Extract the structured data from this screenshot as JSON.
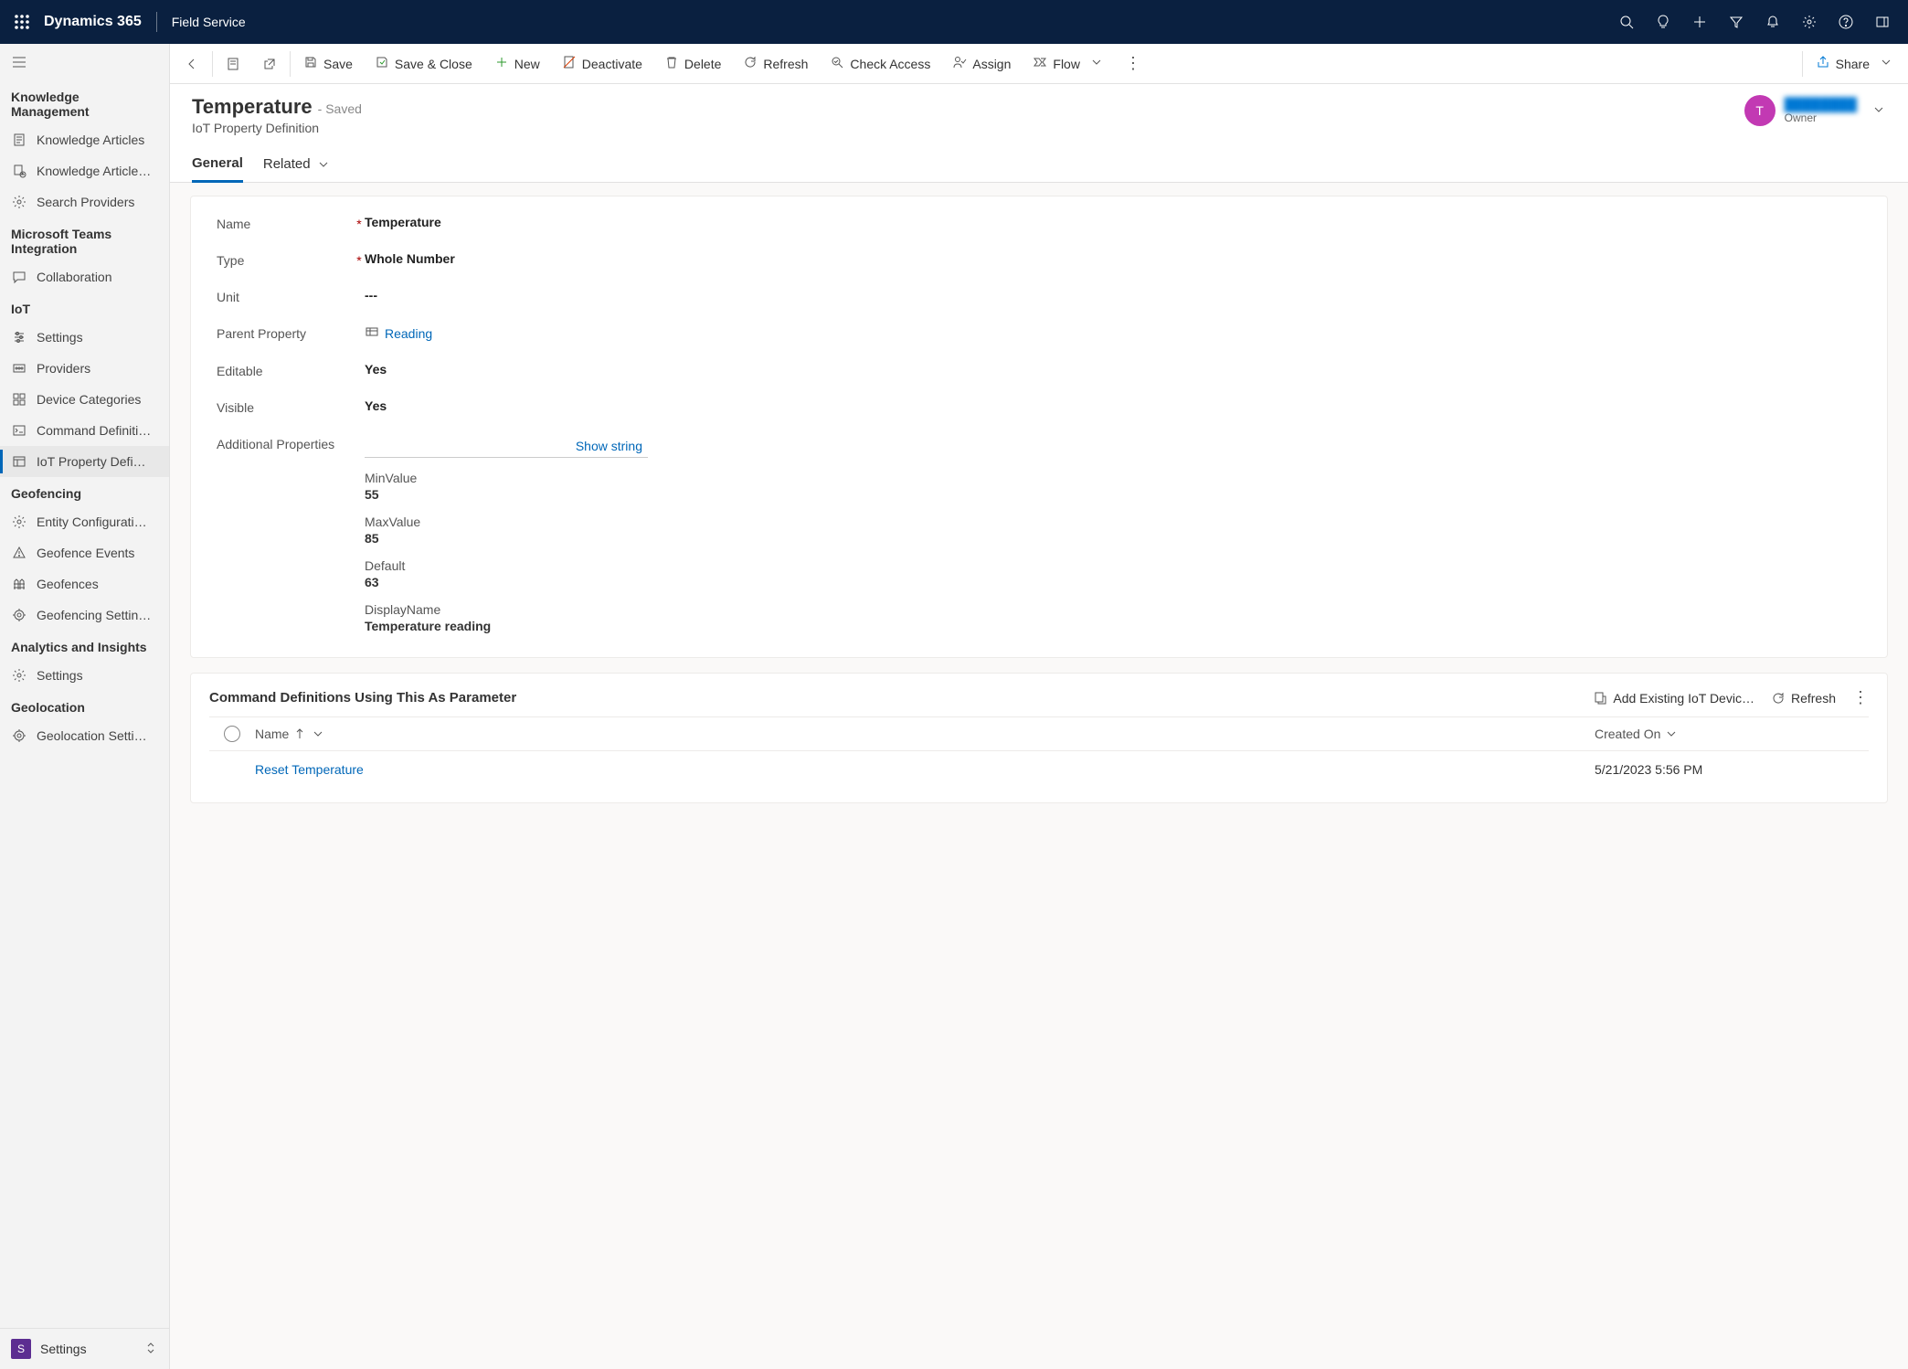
{
  "topbar": {
    "brand": "Dynamics 365",
    "app": "Field Service"
  },
  "sidebar": {
    "groups": [
      {
        "title": "Knowledge Management",
        "items": [
          {
            "label": "Knowledge Articles",
            "icon": "doc"
          },
          {
            "label": "Knowledge Article…",
            "icon": "doc-clock"
          },
          {
            "label": "Search Providers",
            "icon": "gear"
          }
        ]
      },
      {
        "title": "Microsoft Teams Integration",
        "items": [
          {
            "label": "Collaboration",
            "icon": "chat"
          }
        ]
      },
      {
        "title": "IoT",
        "items": [
          {
            "label": "Settings",
            "icon": "sliders"
          },
          {
            "label": "Providers",
            "icon": "provider"
          },
          {
            "label": "Device Categories",
            "icon": "category"
          },
          {
            "label": "Command Definiti…",
            "icon": "terminal"
          },
          {
            "label": "IoT Property Defi…",
            "icon": "property",
            "active": true
          }
        ]
      },
      {
        "title": "Geofencing",
        "items": [
          {
            "label": "Entity Configurati…",
            "icon": "gear"
          },
          {
            "label": "Geofence Events",
            "icon": "warning"
          },
          {
            "label": "Geofences",
            "icon": "fence"
          },
          {
            "label": "Geofencing Settin…",
            "icon": "target"
          }
        ]
      },
      {
        "title": "Analytics and Insights",
        "items": [
          {
            "label": "Settings",
            "icon": "gear"
          }
        ]
      },
      {
        "title": "Geolocation",
        "items": [
          {
            "label": "Geolocation Setti…",
            "icon": "target"
          }
        ]
      }
    ],
    "site": {
      "badge": "S",
      "label": "Settings"
    }
  },
  "cmdbar": {
    "save": "Save",
    "saveclose": "Save & Close",
    "new": "New",
    "deactivate": "Deactivate",
    "delete": "Delete",
    "refresh": "Refresh",
    "checkaccess": "Check Access",
    "assign": "Assign",
    "flow": "Flow",
    "share": "Share"
  },
  "record": {
    "title": "Temperature",
    "status": "- Saved",
    "entity": "IoT Property Definition",
    "owner_initial": "T",
    "owner_name": "████████",
    "owner_role": "Owner"
  },
  "tabs": {
    "general": "General",
    "related": "Related"
  },
  "form": {
    "name_label": "Name",
    "name": "Temperature",
    "type_label": "Type",
    "type": "Whole Number",
    "unit_label": "Unit",
    "unit": "---",
    "parent_label": "Parent Property",
    "parent": "Reading",
    "editable_label": "Editable",
    "editable": "Yes",
    "visible_label": "Visible",
    "visible": "Yes",
    "addprops_label": "Additional Properties",
    "show_string": "Show string",
    "addprops": {
      "minvalue_label": "MinValue",
      "minvalue": "55",
      "maxvalue_label": "MaxValue",
      "maxvalue": "85",
      "default_label": "Default",
      "default": "63",
      "displayname_label": "DisplayName",
      "displayname": "Temperature reading"
    }
  },
  "subgrid": {
    "title": "Command Definitions Using This As Parameter",
    "add": "Add Existing IoT Devic…",
    "refresh": "Refresh",
    "col_name": "Name",
    "col_created": "Created On",
    "rows": [
      {
        "name": "Reset Temperature",
        "created": "5/21/2023 5:56 PM"
      }
    ]
  }
}
